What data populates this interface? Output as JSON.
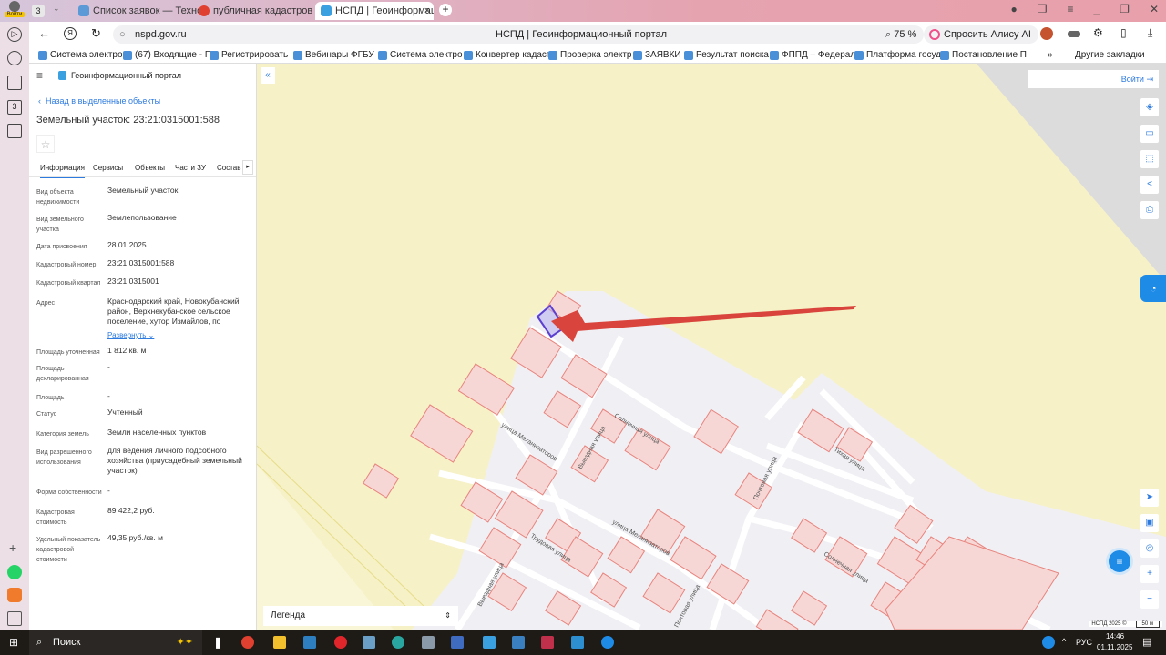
{
  "browser": {
    "tab_count": "3",
    "login_badge": "Войти",
    "tabs": [
      {
        "label": "Список заявок — ТехноК"
      },
      {
        "label": "публичная кадастровая"
      },
      {
        "label": "НСПД | Геоинформаци"
      }
    ],
    "url": "nspd.gov.ru",
    "page_title": "НСПД | Геоинформационный портал",
    "zoom": "75 %",
    "alice": "Спросить Алису AI",
    "bookmarks": [
      "Система электро",
      "(67) Входящие - П",
      "Регистрировать",
      "Вебинары ФГБУ",
      "Система электро",
      "Конвертер кадаст",
      "Проверка электр",
      "ЗАЯВКИ",
      "Результат поиска",
      "ФППД – Федерал",
      "Платформа госуд",
      "Постановление П"
    ],
    "other_bookmarks": "Другие закладки"
  },
  "panel": {
    "app_title": "Геоинформационный портал",
    "back": "Назад в выделенные объекты",
    "title": "Земельный участок: 23:21:0315001:588",
    "tabs": [
      "Информация",
      "Сервисы",
      "Объекты",
      "Части ЗУ",
      "Состав"
    ],
    "fields": [
      {
        "label": "Вид объекта недвижимости",
        "value": "Земельный участок"
      },
      {
        "label": "Вид земельного участка",
        "value": "Землепользование"
      },
      {
        "label": "Дата присвоения",
        "value": "28.01.2025"
      },
      {
        "label": "Кадастровый номер",
        "value": "23:21:0315001:588"
      },
      {
        "label": "Кадастровый квартал",
        "value": "23:21:0315001"
      },
      {
        "label": "Адрес",
        "value": "Краснодарский край, Новокубанский район, Верхнекубанское сельское поселение, хутор Измайлов, по"
      },
      {
        "label": "Площадь уточненная",
        "value": "1 812 кв. м"
      },
      {
        "label": "Площадь декларированная",
        "value": "-"
      },
      {
        "label": "Площадь",
        "value": "-"
      },
      {
        "label": "Статус",
        "value": "Учтенный"
      },
      {
        "label": "Категория земель",
        "value": "Земли населенных пунктов"
      },
      {
        "label": "Вид разрешенного использования",
        "value": "для ведения личного подсобного хозяйства (приусадебный земельный участок)"
      },
      {
        "label": "Форма собственности",
        "value": "-"
      },
      {
        "label": "Кадастровая стоимость",
        "value": "89 422,2 руб."
      },
      {
        "label": "Удельный показатель кадастровой стоимости",
        "value": "49,35 руб./кв. м"
      }
    ],
    "expand": "Развернуть"
  },
  "map": {
    "login": "Войти",
    "legend": "Легенда",
    "streets": [
      "Солнечная улица",
      "улица Механизаторов",
      "Выездная улица",
      "Трудовая улица",
      "Почтовая улица",
      "Тихая улица",
      "улица Механизаторов",
      "Солнечная улица",
      "Выездная улица",
      "Почтовая улица"
    ],
    "copyright": "НСПД 2025 ©",
    "scale": "50 м"
  },
  "taskbar": {
    "search": "Поиск",
    "lang": "РУС",
    "time": "14:46",
    "date": "01.11.2025"
  },
  "colors": {
    "accent": "#2e7be0",
    "parcel": "#e8857f",
    "arrow": "#d9453c"
  }
}
